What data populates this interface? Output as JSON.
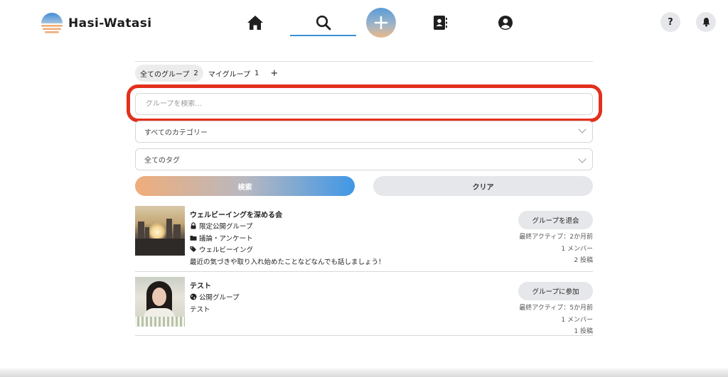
{
  "brand": {
    "name": "Hasi-Watasi"
  },
  "nav": {
    "items": [
      {
        "id": "home",
        "icon": "home-icon"
      },
      {
        "id": "search",
        "icon": "search-icon",
        "active": true
      },
      {
        "id": "add",
        "icon": "plus-icon"
      },
      {
        "id": "contacts",
        "icon": "contact-book-icon"
      },
      {
        "id": "profile",
        "icon": "user-circle-icon"
      }
    ],
    "help_label": "?",
    "bell_icon": "bell-icon"
  },
  "tabs": [
    {
      "label": "全てのグループ",
      "count": "2",
      "active": true
    },
    {
      "label": "マイグループ",
      "count": "1",
      "active": false
    }
  ],
  "tab_add_label": "+",
  "filters": {
    "search_placeholder": "グループを検索...",
    "search_value": "",
    "category_selected": "すべてのカテゴリー",
    "tag_selected": "全てのタグ"
  },
  "buttons": {
    "search": "検索",
    "clear": "クリア"
  },
  "groups": [
    {
      "name": "ウェルビーイングを深める会",
      "visibility": "限定公開グループ",
      "visibility_icon": "lock-icon",
      "category": "議論・アンケート",
      "category_icon": "folder-icon",
      "tags": "ウェルビーイング",
      "tags_icon": "tag-icon",
      "description": "最近の気づきや取り入れ始めたことなどなんでも話しましょう！",
      "action": "グループを退会",
      "last_active": "最終アクティブ：2か月前",
      "members": "1 メンバー",
      "posts": "2 投稿"
    },
    {
      "name": "テスト",
      "visibility": "公開グループ",
      "visibility_icon": "globe-icon",
      "description": "テスト",
      "action": "グループに参加",
      "last_active": "最終アクティブ：5か月前",
      "members": "1 メンバー",
      "posts": "1 投稿"
    }
  ],
  "colors": {
    "accent_blue": "#3c8fd6",
    "highlight_red": "#e2301d",
    "gradient_orange": "#f0ad7a",
    "gradient_blue": "#3f97e6",
    "button_gray": "#e6e7ea"
  }
}
